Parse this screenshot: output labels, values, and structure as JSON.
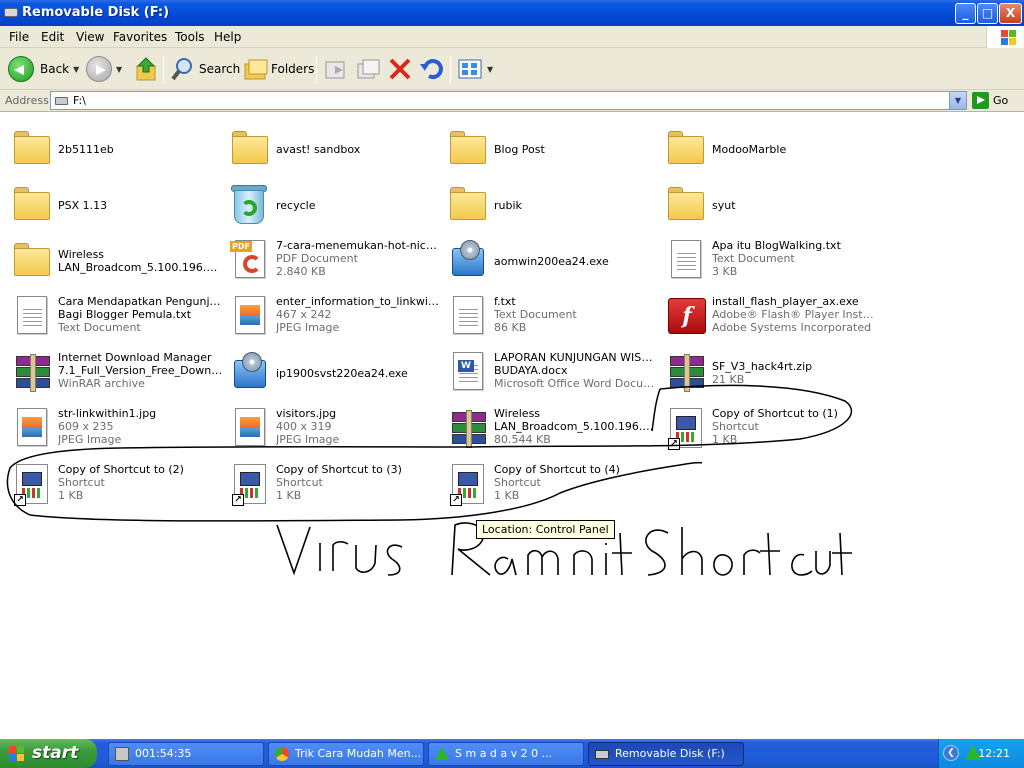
{
  "window": {
    "title": "Removable Disk (F:)",
    "min": "_",
    "max": "□",
    "close": "X"
  },
  "menu": [
    "File",
    "Edit",
    "View",
    "Favorites",
    "Tools",
    "Help"
  ],
  "toolbar": {
    "back": "Back",
    "search": "Search",
    "folders": "Folders"
  },
  "address": {
    "label": "Address",
    "value": "F:\\",
    "go": "Go"
  },
  "items": [
    {
      "lines": [
        "2b5111eb"
      ],
      "icon": "folder"
    },
    {
      "lines": [
        "avast! sandbox"
      ],
      "icon": "folder"
    },
    {
      "lines": [
        "Blog Post"
      ],
      "icon": "folder"
    },
    {
      "lines": [
        "ModooMarble"
      ],
      "icon": "folder"
    },
    {
      "lines": [
        "PSX 1.13"
      ],
      "icon": "folder"
    },
    {
      "lines": [
        "recycle"
      ],
      "icon": "recycle"
    },
    {
      "lines": [
        "rubik"
      ],
      "icon": "folder"
    },
    {
      "lines": [
        "syut"
      ],
      "icon": "folder"
    },
    {
      "lines": [
        "Wireless",
        "LAN_Broadcom_5.100.196.8_..."
      ],
      "icon": "folder"
    },
    {
      "lines": [
        "7-cara-menemukan-hot-niche....",
        "PDF Document",
        "2.840 KB"
      ],
      "icon": "pdf"
    },
    {
      "lines": [
        "aomwin200ea24.exe"
      ],
      "icon": "setup"
    },
    {
      "lines": [
        "Apa itu BlogWalking.txt",
        "Text Document",
        "3 KB"
      ],
      "icon": "text"
    },
    {
      "lines": [
        "Cara Mendapatkan Pengunjung",
        "Bagi Blogger Pemula.txt",
        "Text Document"
      ],
      "icon": "text"
    },
    {
      "lines": [
        "enter_information_to_linkwithi...",
        "467 x 242",
        "JPEG Image"
      ],
      "icon": "jpeg"
    },
    {
      "lines": [
        "f.txt",
        "Text Document",
        "86 KB"
      ],
      "icon": "text"
    },
    {
      "lines": [
        "install_flash_player_ax.exe",
        "Adobe® Flash® Player Install...",
        "Adobe Systems Incorporated"
      ],
      "icon": "flash"
    },
    {
      "lines": [
        "Internet Download Manager",
        "7.1_Full_Version_Free_Downl...",
        "WinRAR archive"
      ],
      "icon": "winrar"
    },
    {
      "lines": [
        "ip1900svst220ea24.exe"
      ],
      "icon": "setup"
    },
    {
      "lines": [
        "LAPORAN KUNJUNGAN WISATA",
        "BUDAYA.docx",
        "Microsoft Office Word Document"
      ],
      "icon": "word"
    },
    {
      "lines": [
        "SF_V3_hack4rt.zip",
        "21 KB"
      ],
      "icon": "winrar"
    },
    {
      "lines": [
        "str-linkwithin1.jpg",
        "609 x 235",
        "JPEG Image"
      ],
      "icon": "jpeg"
    },
    {
      "lines": [
        "visitors.jpg",
        "400 x 319",
        "JPEG Image"
      ],
      "icon": "jpeg"
    },
    {
      "lines": [
        "Wireless",
        "LAN_Broadcom_5.100.196.8_...",
        "80.544 KB"
      ],
      "icon": "winrar"
    },
    {
      "lines": [
        "Copy of Shortcut to (1)",
        "Shortcut",
        "1 KB"
      ],
      "icon": "shortcut"
    },
    {
      "lines": [
        "Copy of Shortcut to (2)",
        "Shortcut",
        "1 KB"
      ],
      "icon": "shortcut"
    },
    {
      "lines": [
        "Copy of Shortcut to (3)",
        "Shortcut",
        "1 KB"
      ],
      "icon": "shortcut"
    },
    {
      "lines": [
        "Copy of Shortcut to (4)",
        "Shortcut",
        "1 KB"
      ],
      "icon": "shortcut"
    }
  ],
  "tooltip": "Location: Control Panel",
  "annotation_text": "Virus Ramnit Shortcut",
  "taskbar": {
    "start": "start",
    "tasks": [
      {
        "label": "001:54:35",
        "icon": "computer-icon"
      },
      {
        "label": "Trik Cara Mudah Men...",
        "icon": "chrome-icon"
      },
      {
        "label": "S m a d a v   2 0 ...",
        "icon": "smadav-icon"
      },
      {
        "label": "Removable Disk (F:)",
        "icon": "drive-icon",
        "active": true
      }
    ],
    "clock": "12:21"
  },
  "colors": {
    "titlebar": "#0549d6",
    "taskbar": "#245edb",
    "start": "#3c9a3c",
    "tooltip": "#ffffe1"
  }
}
